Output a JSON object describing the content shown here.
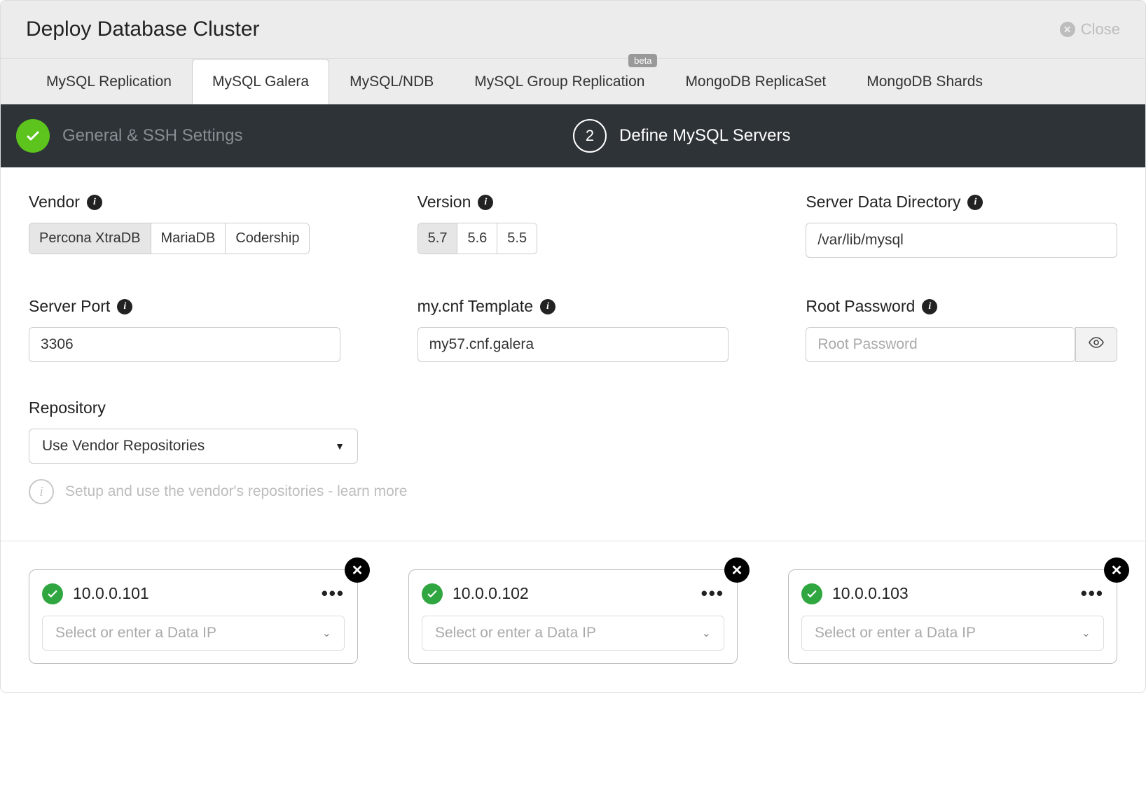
{
  "header": {
    "title": "Deploy Database Cluster",
    "close_label": "Close"
  },
  "tabs": {
    "items": [
      {
        "label": "MySQL Replication"
      },
      {
        "label": "MySQL Galera"
      },
      {
        "label": "MySQL/NDB"
      },
      {
        "label": "MySQL Group Replication",
        "badge": "beta"
      },
      {
        "label": "MongoDB ReplicaSet"
      },
      {
        "label": "MongoDB Shards"
      }
    ]
  },
  "steps": {
    "step1_label": "General & SSH Settings",
    "step2_number": "2",
    "step2_label": "Define MySQL Servers"
  },
  "form": {
    "vendor_label": "Vendor",
    "vendor_options": [
      "Percona XtraDB",
      "MariaDB",
      "Codership"
    ],
    "version_label": "Version",
    "version_options": [
      "5.7",
      "5.6",
      "5.5"
    ],
    "data_dir_label": "Server Data Directory",
    "data_dir_value": "/var/lib/mysql",
    "port_label": "Server Port",
    "port_value": "3306",
    "mycnf_label": "my.cnf Template",
    "mycnf_value": "my57.cnf.galera",
    "rootpw_label": "Root Password",
    "rootpw_placeholder": "Root Password",
    "repo_label": "Repository",
    "repo_value": "Use Vendor Repositories",
    "repo_hint": "Setup and use the vendor's repositories - learn more"
  },
  "servers": {
    "data_ip_placeholder": "Select or enter a Data IP",
    "items": [
      {
        "ip": "10.0.0.101"
      },
      {
        "ip": "10.0.0.102"
      },
      {
        "ip": "10.0.0.103"
      }
    ]
  }
}
